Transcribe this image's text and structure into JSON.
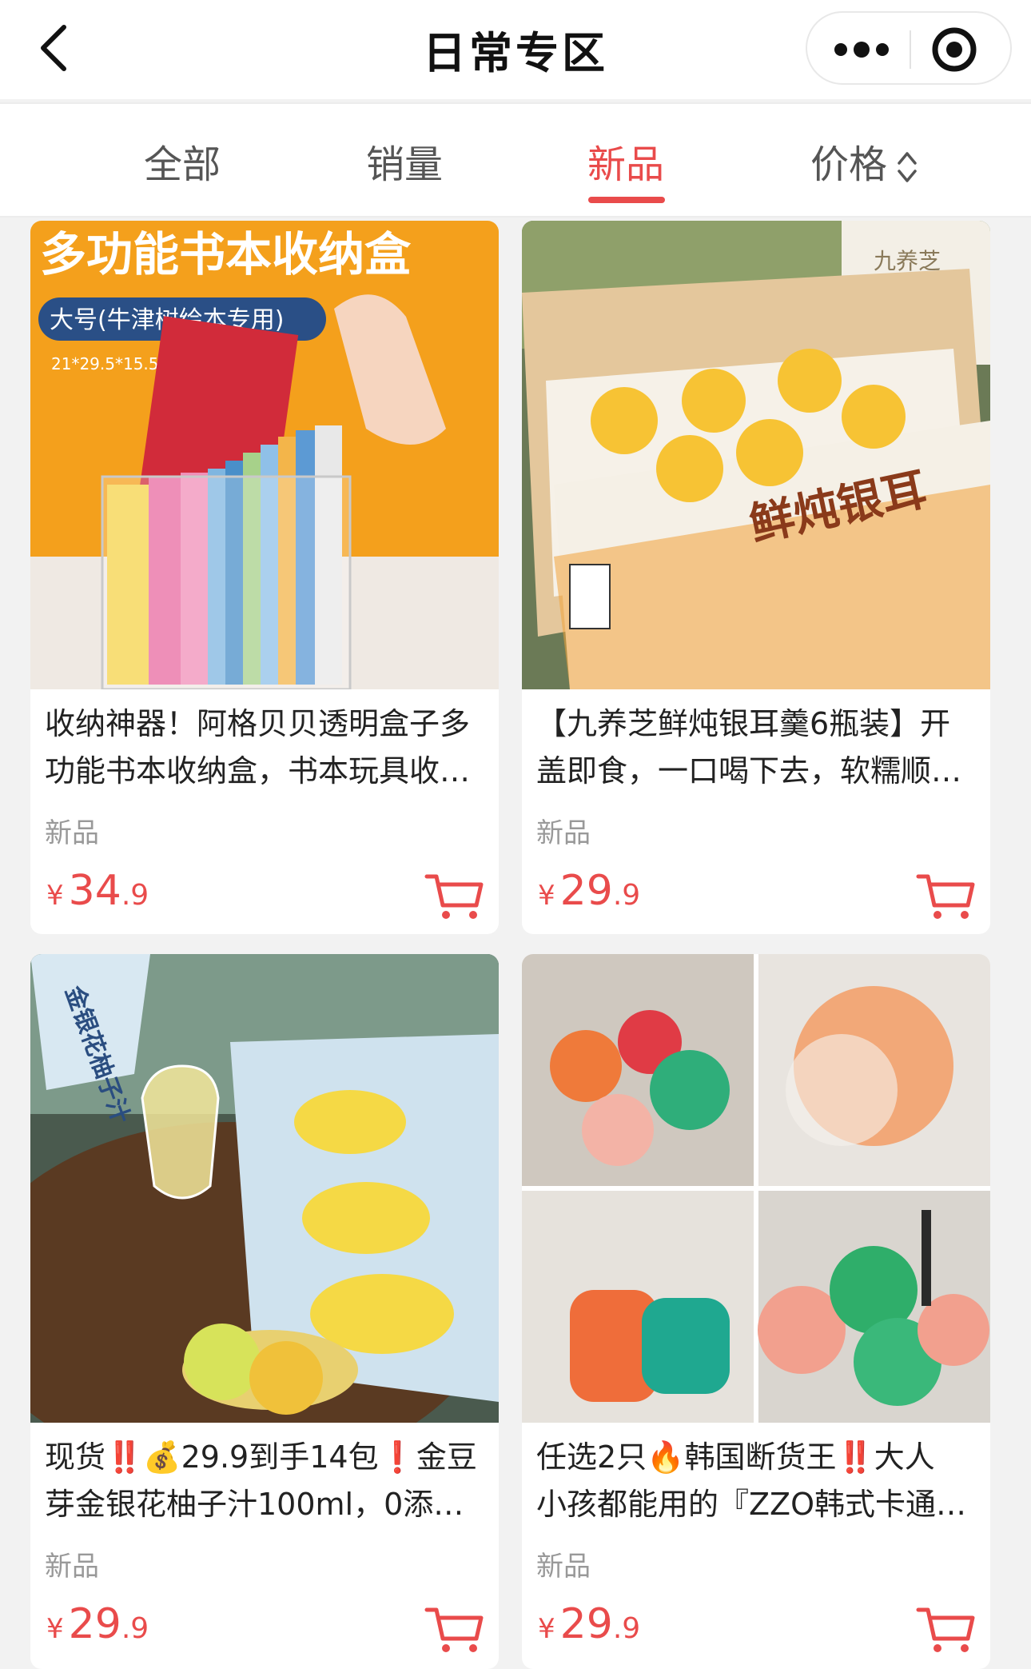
{
  "header": {
    "title": "日常专区",
    "back_icon": "chevron-left-icon",
    "more_icon": "more-dots-icon",
    "record_icon": "record-icon"
  },
  "tabs": [
    {
      "label": "全部",
      "active": false
    },
    {
      "label": "销量",
      "active": false
    },
    {
      "label": "新品",
      "active": true
    },
    {
      "label": "价格",
      "active": false,
      "icon": "sort-updown-icon"
    }
  ],
  "colors": {
    "accent": "#e94b4b",
    "tag_gray": "#999999",
    "background": "#f2f2f2"
  },
  "products": [
    {
      "name_line1": "收纳神器！阿格贝贝透明盒子多",
      "name_line2": "功能书本收纳盒，书本玩具收…",
      "tag": "新品",
      "currency": "¥",
      "price_int": "34",
      "price_dec": ".9",
      "image": {
        "banner": "多功能书本收纳盒",
        "sub": "大号(牛津树绘本专用)",
        "size": "21*29.5*15.5cm"
      }
    },
    {
      "name_line1": "【九养芝鲜炖银耳羹6瓶装】开",
      "name_line2": "盖即食，一口喝下去，软糯顺…",
      "tag": "新品",
      "currency": "¥",
      "price_int": "29",
      "price_dec": ".9",
      "image": {
        "brand": "九养芝",
        "box_text": "鲜炖银耳"
      }
    },
    {
      "name_line1": "现货‼️💰29.9到手14包❗金豆",
      "name_line2": "芽金银花柚子汁100ml，0添…",
      "tag": "新品",
      "currency": "¥",
      "price_int": "29",
      "price_dec": ".9",
      "image": {
        "pouch_text": "金银花柚子汁"
      }
    },
    {
      "name_line1": "任选2只🔥韩国断货王‼️大人",
      "name_line2": "小孩都能用的『ZZO韩式卡通…",
      "tag": "新品",
      "currency": "¥",
      "price_int": "29",
      "price_dec": ".9",
      "image": {}
    }
  ]
}
